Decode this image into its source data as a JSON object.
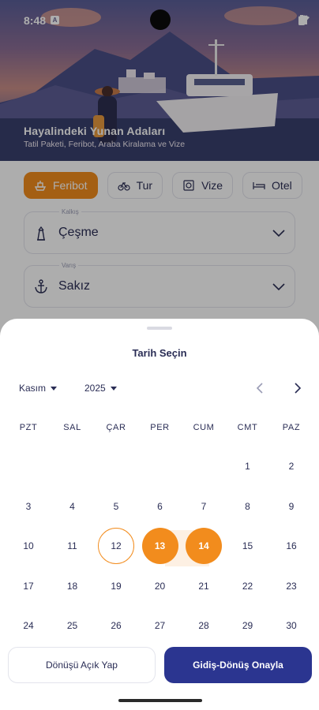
{
  "status_bar": {
    "time": "8:48",
    "notification_glyph": "A",
    "icons": [
      "wifi-icon",
      "signal-icon",
      "battery-icon"
    ]
  },
  "hero": {
    "title": "Hayalindeki Yunan Adaları",
    "subtitle": "Tatil Paketi, Feribot, Araba Kiralama ve Vize"
  },
  "tabs": [
    {
      "label": "Feribot",
      "icon": "ferry-icon",
      "active": true
    },
    {
      "label": "Tur",
      "icon": "bicycle-icon",
      "active": false
    },
    {
      "label": "Vize",
      "icon": "passport-icon",
      "active": false
    },
    {
      "label": "Otel",
      "icon": "bed-icon",
      "active": false
    }
  ],
  "form": {
    "departure": {
      "label": "Kalkış",
      "value": "Çeşme",
      "icon": "lighthouse-icon"
    },
    "arrival": {
      "label": "Varış",
      "value": "Sakız",
      "icon": "anchor-icon"
    }
  },
  "date_picker": {
    "title": "Tarih Seçin",
    "month": "Kasım",
    "year": "2025",
    "weekdays": [
      "PZT",
      "SAL",
      "ÇAR",
      "PER",
      "CUM",
      "CMT",
      "PAZ"
    ],
    "rows": [
      [
        "",
        "",
        "",
        "",
        "",
        "1",
        "2"
      ],
      [
        "3",
        "4",
        "5",
        "6",
        "7",
        "8",
        "9"
      ],
      [
        "10",
        "11",
        "12",
        "13",
        "14",
        "15",
        "16"
      ],
      [
        "17",
        "18",
        "19",
        "20",
        "21",
        "22",
        "23"
      ],
      [
        "24",
        "25",
        "26",
        "27",
        "28",
        "29",
        "30"
      ]
    ],
    "today": "12",
    "selected_start": "13",
    "selected_end": "14"
  },
  "actions": {
    "open_return_label": "Dönüşü Açık Yap",
    "confirm_label": "Gidiş-Dönüş Onayla"
  },
  "colors": {
    "accent": "#f28c1d",
    "primary": "#2b3590",
    "text": "#2a2d55"
  }
}
